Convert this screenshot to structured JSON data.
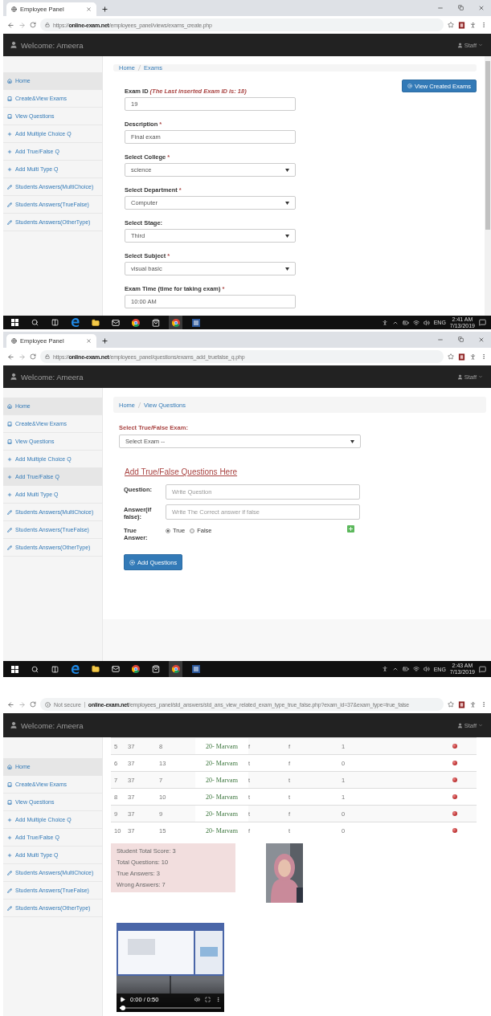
{
  "screens": [
    {
      "kind": "exam_form",
      "tab": {
        "title": "Employee Panel"
      },
      "address": {
        "scheme": "https://",
        "host": "online-exam.net",
        "path": "/employees_panel/views/exams_create.php"
      },
      "header": {
        "welcome": "Welcome: Ameera",
        "user": "Staff"
      },
      "sidebar": [
        {
          "label": "Home",
          "selected": true
        },
        {
          "label": "Create&View Exams",
          "selected": false
        },
        {
          "label": "View Questions",
          "selected": false
        },
        {
          "label": "Add Multiple Choice Q",
          "selected": false
        },
        {
          "label": "Add True/False Q",
          "selected": false
        },
        {
          "label": "Add Multi Type Q",
          "selected": false
        },
        {
          "label": "Students Answers(MultiChoice)",
          "selected": false
        },
        {
          "label": "Students Answers(TrueFalse)",
          "selected": false
        },
        {
          "label": "Students Answers(OtherType)",
          "selected": false
        }
      ],
      "breadcrumb": [
        "Home",
        "Exams"
      ],
      "action_button": "View Created Exams",
      "fields": [
        {
          "kind": "input",
          "label": "Exam ID",
          "note": "(The Last inserted Exam ID is: 18)",
          "value": "19"
        },
        {
          "kind": "input",
          "label": "Description",
          "mark": "*",
          "value": "Final exam"
        },
        {
          "kind": "select",
          "label": "Select College",
          "mark": "*",
          "value": "science"
        },
        {
          "kind": "select",
          "label": "Select Department",
          "mark": "*",
          "value": "Computer"
        },
        {
          "kind": "select",
          "label": "Select Stage:",
          "value": "Third"
        },
        {
          "kind": "select",
          "label": "Select Subject",
          "mark": "*",
          "value": "visual basic"
        },
        {
          "kind": "input",
          "label": "Exam Time (time for taking exam)",
          "mark": "*",
          "value": "10:00 AM"
        }
      ],
      "taskbar": {
        "lang": "ENG",
        "time": "2:41 AM",
        "date": "7/13/2019"
      }
    },
    {
      "kind": "truefalse_form",
      "tab": {
        "title": "Employee Panel"
      },
      "address": {
        "scheme": "https://",
        "host": "online-exam.net",
        "path": "/employees_panel/questions/exams_add_truefalse_q.php"
      },
      "header": {
        "welcome": "Welcome: Ameera",
        "user": "Staff"
      },
      "sidebar": [
        {
          "label": "Home",
          "selected": true
        },
        {
          "label": "Create&View Exams",
          "selected": false
        },
        {
          "label": "View Questions",
          "selected": false
        },
        {
          "label": "Add Multiple Choice Q",
          "selected": false
        },
        {
          "label": "Add True/False Q",
          "selected": true
        },
        {
          "label": "Add Multi Type Q",
          "selected": false
        },
        {
          "label": "Students Answers(MultiChoice)",
          "selected": false
        },
        {
          "label": "Students Answers(TrueFalse)",
          "selected": false
        },
        {
          "label": "Students Answers(OtherType)",
          "selected": false
        }
      ],
      "breadcrumb": [
        "Home",
        "View Questions"
      ],
      "exam_select": {
        "label": "Select True/False Exam:",
        "value": "Select Exam --"
      },
      "heading": "Add True/False Questions Here",
      "question": {
        "label": "Question:",
        "placeholder": "Write Question"
      },
      "answer": {
        "label": "Answer(if false):",
        "placeholder": "Write The Correct answer if false"
      },
      "true_answer": {
        "label": "True Answer:",
        "options": [
          {
            "label": "True",
            "selected": true
          },
          {
            "label": "False",
            "selected": false
          }
        ]
      },
      "submit": "Add Questions",
      "taskbar": {
        "lang": "ENG",
        "time": "2:43 AM",
        "date": "7/13/2019"
      }
    },
    {
      "kind": "answers_table",
      "address": {
        "security": "Not secure",
        "host": "online-exam.net",
        "path": "/employees_panel/std_answers/std_ans_view_related_exam_type_true_false.php?exam_id=37&exam_type=true_false"
      },
      "header": {
        "welcome": "Welcome: Ameera",
        "user": "Staff"
      },
      "sidebar": [
        {
          "label": "Home",
          "selected": true
        },
        {
          "label": "Create&View Exams",
          "selected": false
        },
        {
          "label": "View Questions",
          "selected": false
        },
        {
          "label": "Add Multiple Choice Q",
          "selected": false
        },
        {
          "label": "Add True/False Q",
          "selected": false
        },
        {
          "label": "Add Multi Type Q",
          "selected": false
        },
        {
          "label": "Students Answers(MultiChoice)",
          "selected": false
        },
        {
          "label": "Students Answers(TrueFalse)",
          "selected": false
        },
        {
          "label": "Students Answers(OtherType)",
          "selected": false
        }
      ],
      "table": {
        "rows": [
          [
            "5",
            "37",
            "8",
            "20- Marvam",
            "f",
            "f",
            "1"
          ],
          [
            "6",
            "37",
            "13",
            "20- Marvam",
            "t",
            "f",
            "0"
          ],
          [
            "7",
            "37",
            "7",
            "20- Marvam",
            "t",
            "t",
            "1"
          ],
          [
            "8",
            "37",
            "10",
            "20- Marvam",
            "t",
            "t",
            "1"
          ],
          [
            "9",
            "37",
            "9",
            "20- Marvam",
            "t",
            "f",
            "0"
          ],
          [
            "10",
            "37",
            "15",
            "20- Marvam",
            "f",
            "t",
            "0"
          ]
        ]
      },
      "summary": [
        "Student Total Score: 3",
        "Total Questions: 10",
        "True Answers: 3",
        "Wrong Answers: 7"
      ],
      "video": {
        "time": "0:00 / 0:50",
        "level": 0.03
      }
    }
  ]
}
